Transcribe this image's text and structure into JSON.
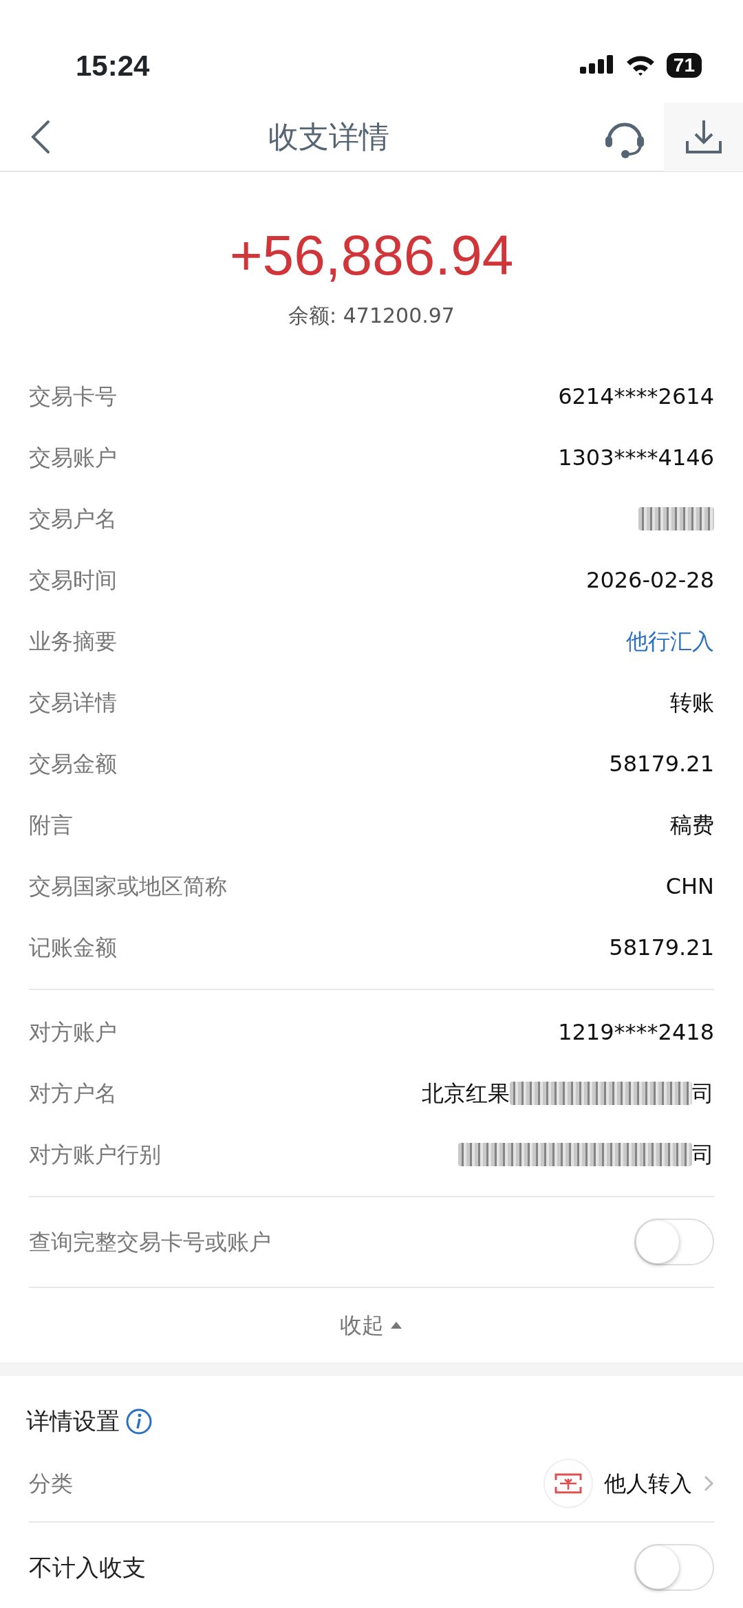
{
  "status_bar": {
    "time": "15:24",
    "battery": "71"
  },
  "header": {
    "title": "收支详情"
  },
  "summary": {
    "amount": "+56,886.94",
    "balance": "余额: 471200.97"
  },
  "detail_groups": [
    [
      {
        "kind": "text",
        "label": "交易卡号",
        "value": "6214****2614"
      },
      {
        "kind": "text",
        "label": "交易账户",
        "value": "1303****4146"
      },
      {
        "kind": "redacted",
        "label": "交易户名"
      },
      {
        "kind": "text",
        "label": "交易时间",
        "value": "2026-02-28"
      },
      {
        "kind": "link",
        "label": "业务摘要",
        "value": "他行汇入"
      },
      {
        "kind": "text",
        "label": "交易详情",
        "value": "转账"
      },
      {
        "kind": "text",
        "label": "交易金额",
        "value": "58179.21"
      },
      {
        "kind": "text",
        "label": "附言",
        "value": "稿费"
      },
      {
        "kind": "text",
        "label": "交易国家或地区简称",
        "value": "CHN"
      },
      {
        "kind": "text",
        "label": "记账金额",
        "value": "58179.21"
      }
    ],
    [
      {
        "kind": "text",
        "label": "对方账户",
        "value": "1219****2418"
      },
      {
        "kind": "redacted",
        "label": "对方户名",
        "value_start": "北京红果",
        "value_end": "司"
      },
      {
        "kind": "redacted",
        "label": "对方账户行别",
        "value_end": "司"
      }
    ]
  ],
  "full_number_toggle": {
    "label": "查询完整交易卡号或账户",
    "on": false
  },
  "collapse": {
    "label": "收起",
    "expanded": true
  },
  "settings": {
    "title": "详情设置",
    "category": {
      "label": "分类",
      "value": "他人转入"
    },
    "exclude": {
      "label": "不计入收支",
      "on": false
    }
  }
}
